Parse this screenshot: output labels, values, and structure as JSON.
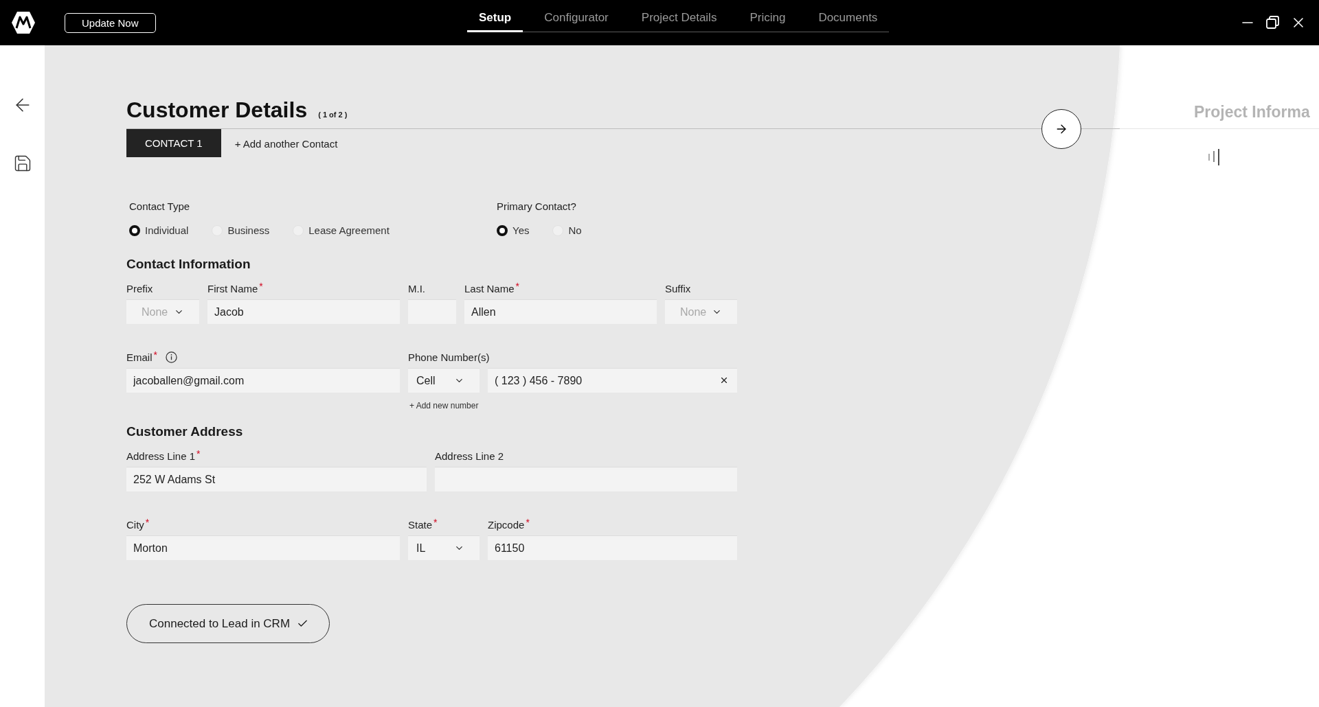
{
  "top_bar": {
    "update_button": "Update Now",
    "tabs": [
      {
        "label": "Setup",
        "selected": true
      },
      {
        "label": "Configurator",
        "selected": false
      },
      {
        "label": "Project Details",
        "selected": false
      },
      {
        "label": "Pricing",
        "selected": false
      },
      {
        "label": "Documents",
        "selected": false
      }
    ]
  },
  "page": {
    "title": "Customer Details",
    "step": "( 1 of 2 )",
    "next_section": "Project Informa",
    "contact_tabs": [
      {
        "label": "CONTACT 1",
        "selected": true
      }
    ],
    "add_contact": "+ Add another Contact",
    "contact_type": {
      "label": "Contact Type",
      "options": [
        {
          "label": "Individual",
          "selected": true
        },
        {
          "label": "Business",
          "selected": false
        },
        {
          "label": "Lease Agreement",
          "selected": false
        }
      ]
    },
    "primary_contact": {
      "label": "Primary Contact?",
      "options": [
        {
          "label": "Yes",
          "selected": true
        },
        {
          "label": "No",
          "selected": false
        }
      ]
    },
    "contact_information": {
      "heading": "Contact Information",
      "fields": [
        {
          "kind": "select",
          "label": "Prefix",
          "placeholder": "None"
        },
        {
          "kind": "text",
          "label": "First Name",
          "mark": "*",
          "value": "Jacob"
        },
        {
          "kind": "text",
          "label": "M.I."
        },
        {
          "kind": "text",
          "label": "Last Name",
          "mark": "*",
          "value": "Allen"
        },
        {
          "kind": "select",
          "label": "Suffix",
          "placeholder": "None"
        },
        {
          "kind": "text",
          "label": "Email",
          "mark": "*",
          "info": true,
          "value": "jacoballen@gmail.com"
        },
        {
          "kind": "phone",
          "label": "Phone Number(s)",
          "type_value": "Cell",
          "value": "( 123 ) 456 - 7890",
          "add_link": "+ Add new number"
        }
      ]
    },
    "customer_address": {
      "heading": "Customer Address",
      "fields": [
        {
          "kind": "text",
          "label": "Address Line 1",
          "mark": "*",
          "value": "252 W Adams St"
        },
        {
          "kind": "text",
          "label": "Address Line 2"
        },
        {
          "kind": "text",
          "label": "City",
          "mark": "*",
          "value": "Morton"
        },
        {
          "kind": "select",
          "label": "State",
          "mark": "*",
          "value": "IL"
        },
        {
          "kind": "text",
          "label": "Zipcode",
          "mark": "*",
          "value": "61150"
        }
      ]
    },
    "crm_button": "Connected to Lead in CRM"
  }
}
